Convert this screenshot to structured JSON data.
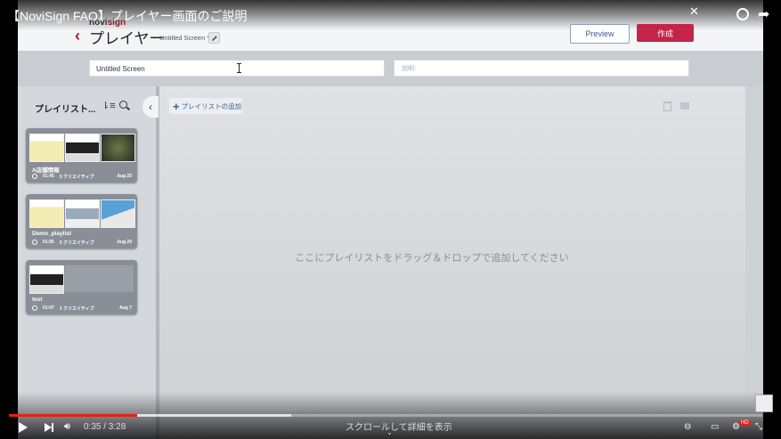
{
  "video": {
    "title": "【NoviSign FAQ】プレイヤー画面のご説明",
    "time": "0:35 / 3:28",
    "progress": 0.17,
    "scroll_hint": "スクロールして詳細を表示",
    "hd_badge": "HD"
  },
  "brand": {
    "logo_prefix": "novi",
    "logo_suffix": "sign"
  },
  "header": {
    "title": "プレイヤー",
    "subtitle": "Untitled Screen *",
    "preview_label": "Preview",
    "create_label": "作成"
  },
  "form": {
    "name_value": "Untitled Screen",
    "description_placeholder": "説明:"
  },
  "sidebar": {
    "title": "プレイリスト..."
  },
  "main": {
    "add_playlist_label": "プレイリストの追加",
    "drop_hint": "ここにプレイリストをドラッグ＆ドロップで追加してください"
  },
  "playlists": [
    {
      "name": "A店舗情報",
      "duration": "01:45",
      "creatives": "3 クリエイティブ",
      "date": "Aug 20"
    },
    {
      "name": "Demo_playlist",
      "duration": "01:55",
      "creatives": "3 クリエイティブ",
      "date": "Aug 20"
    },
    {
      "name": "test",
      "duration": "01:07",
      "creatives": "1 クリエイティブ",
      "date": "Aug 7"
    }
  ],
  "colors": {
    "accent": "#c4234a",
    "progress": "#e62117",
    "link": "#3b5b8f"
  }
}
